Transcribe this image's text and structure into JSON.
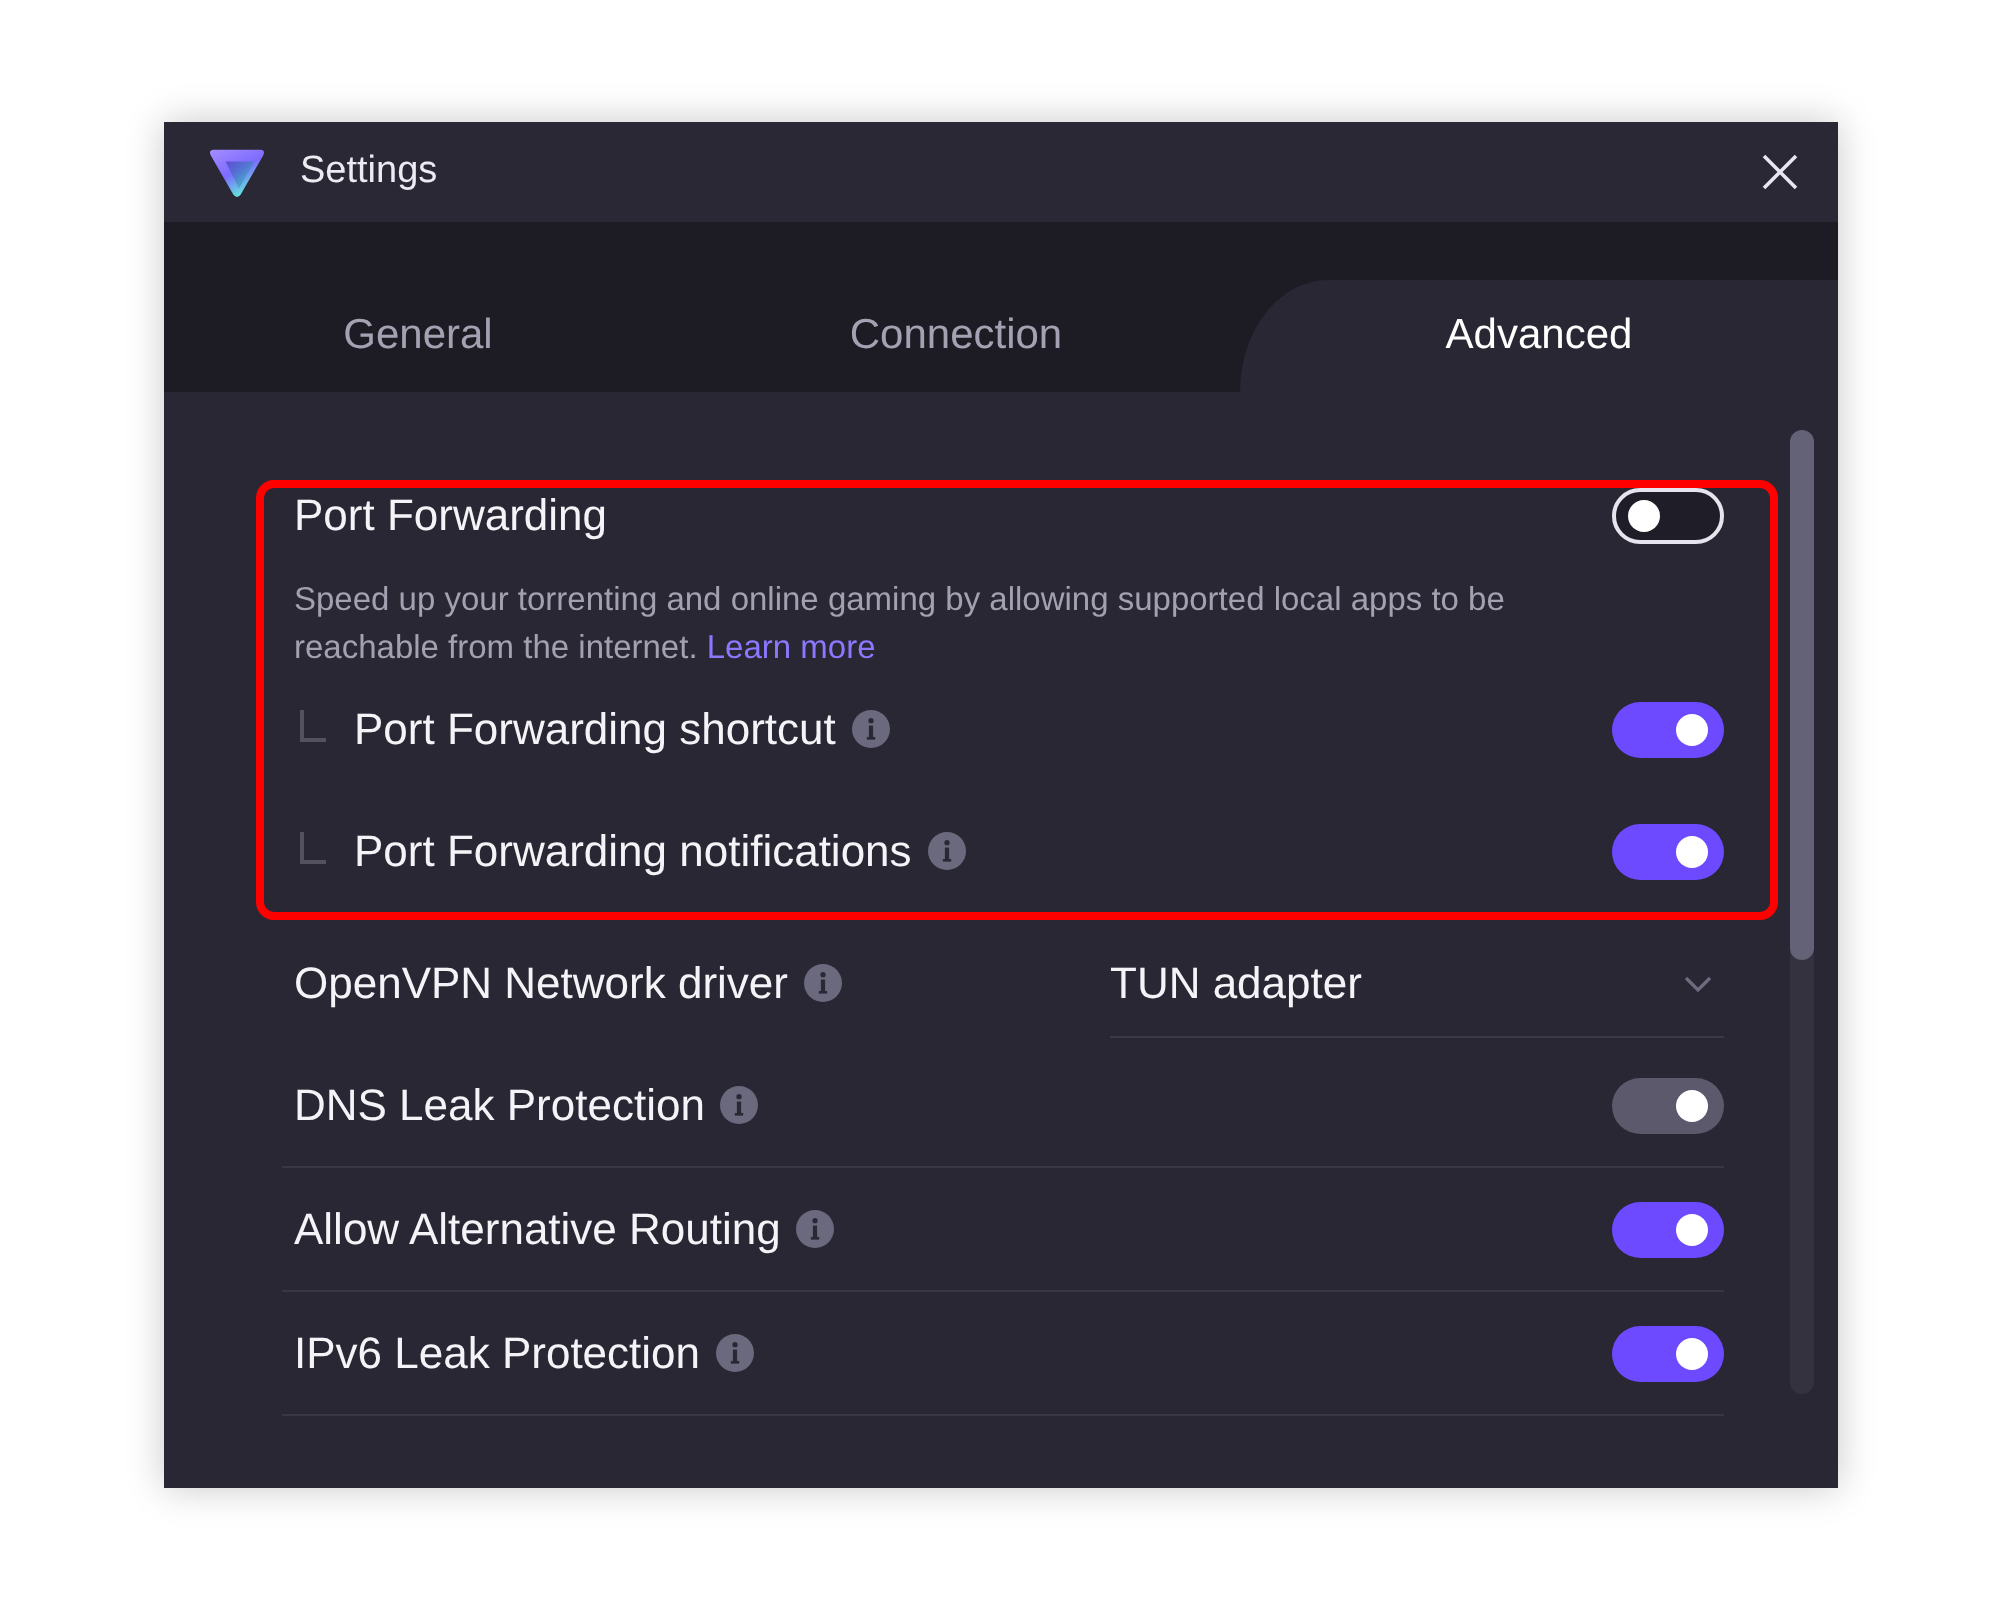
{
  "window": {
    "title": "Settings"
  },
  "tabs": [
    {
      "label": "General",
      "selected": false
    },
    {
      "label": "Connection",
      "selected": false
    },
    {
      "label": "Advanced",
      "selected": true
    }
  ],
  "port_forwarding": {
    "highlighted": true,
    "label": "Port Forwarding",
    "on": false,
    "description": "Speed up your torrenting and online gaming by allowing supported local apps to be reachable from the internet.",
    "link": "Learn more",
    "children": [
      {
        "label": "Port Forwarding shortcut",
        "info": true,
        "on": true
      },
      {
        "label": "Port Forwarding notifications",
        "info": true,
        "on": true
      }
    ]
  },
  "settings": [
    {
      "kind": "dropdown",
      "label": "OpenVPN Network driver",
      "info": true,
      "value": "TUN adapter"
    },
    {
      "kind": "toggle",
      "label": "DNS Leak Protection",
      "info": true,
      "on": true,
      "disabled": true
    },
    {
      "kind": "toggle",
      "label": "Allow Alternative Routing",
      "info": true,
      "on": true,
      "disabled": false
    },
    {
      "kind": "toggle",
      "label": "IPv6 Leak Protection",
      "info": true,
      "on": true,
      "disabled": false
    }
  ]
}
